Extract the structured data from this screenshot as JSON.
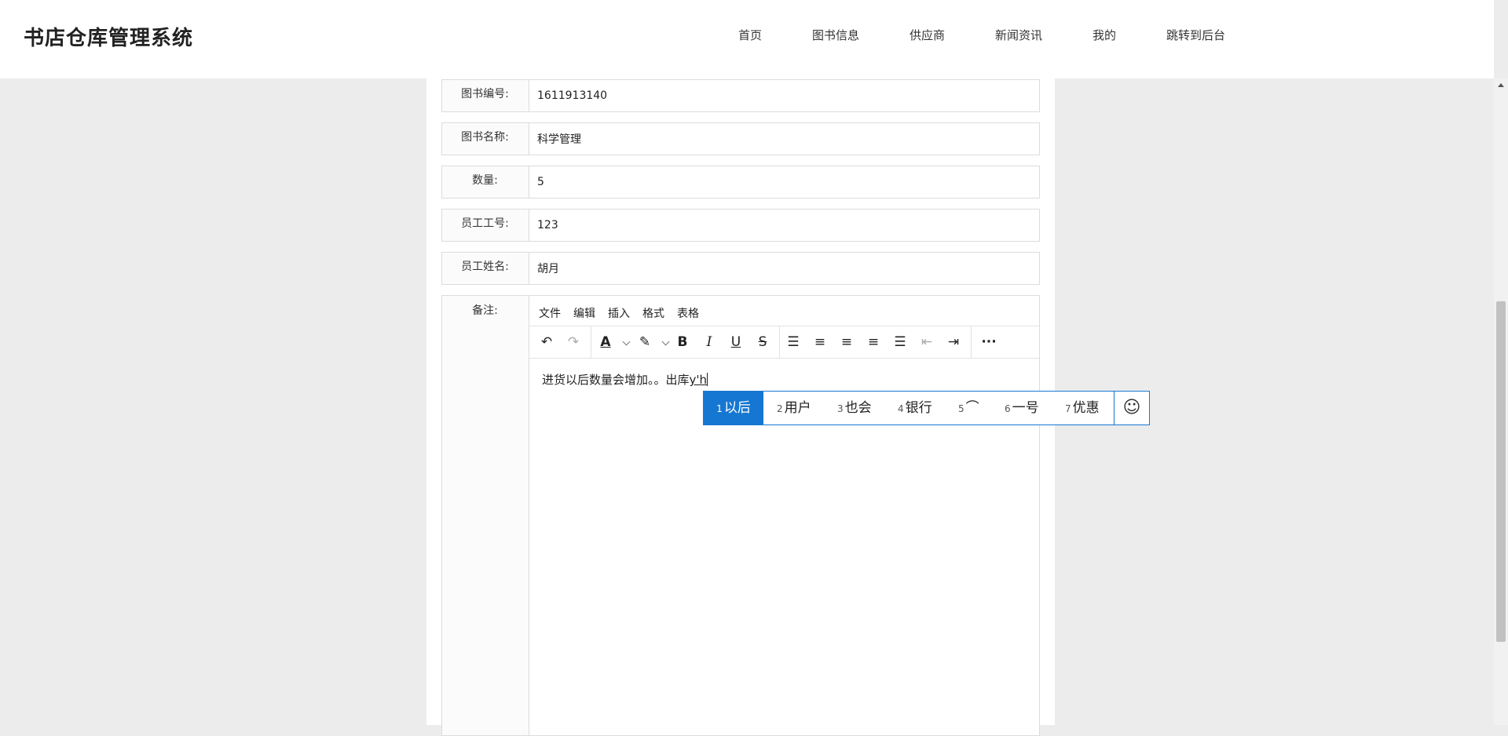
{
  "header": {
    "brand": "书店仓库管理系统",
    "nav": [
      "首页",
      "图书信息",
      "供应商",
      "新闻资讯",
      "我的",
      "跳转到后台"
    ]
  },
  "form": {
    "fields": [
      {
        "label": "图书编号:",
        "value": "1611913140"
      },
      {
        "label": "图书名称:",
        "value": "科学管理"
      },
      {
        "label": "数量:",
        "value": "5"
      },
      {
        "label": "员工工号:",
        "value": "123"
      },
      {
        "label": "员工姓名:",
        "value": "胡月"
      }
    ],
    "remark": {
      "label": "备注:",
      "menu": [
        "文件",
        "编辑",
        "插入",
        "格式",
        "表格"
      ],
      "toolbar": [
        "undo-icon",
        "redo-icon",
        "text-color-icon",
        "highlight-icon",
        "bold-icon",
        "italic-icon",
        "underline-icon",
        "strikethrough-icon",
        "line-height-icon",
        "align-left-icon",
        "align-center-icon",
        "align-right-icon",
        "align-justify-icon",
        "outdent-icon",
        "indent-icon",
        "more-icon"
      ],
      "content": "进货以后数量会增加。。出库",
      "composition": "y'h"
    }
  },
  "ime": {
    "candidates": [
      {
        "num": "1",
        "text": "以后"
      },
      {
        "num": "2",
        "text": "用户"
      },
      {
        "num": "3",
        "text": "也会"
      },
      {
        "num": "4",
        "text": "银行"
      },
      {
        "num": "5",
        "text": "⌒"
      },
      {
        "num": "6",
        "text": "一号"
      },
      {
        "num": "7",
        "text": "优惠"
      }
    ],
    "selected_index": 0,
    "accent_color": "#1677d2"
  }
}
